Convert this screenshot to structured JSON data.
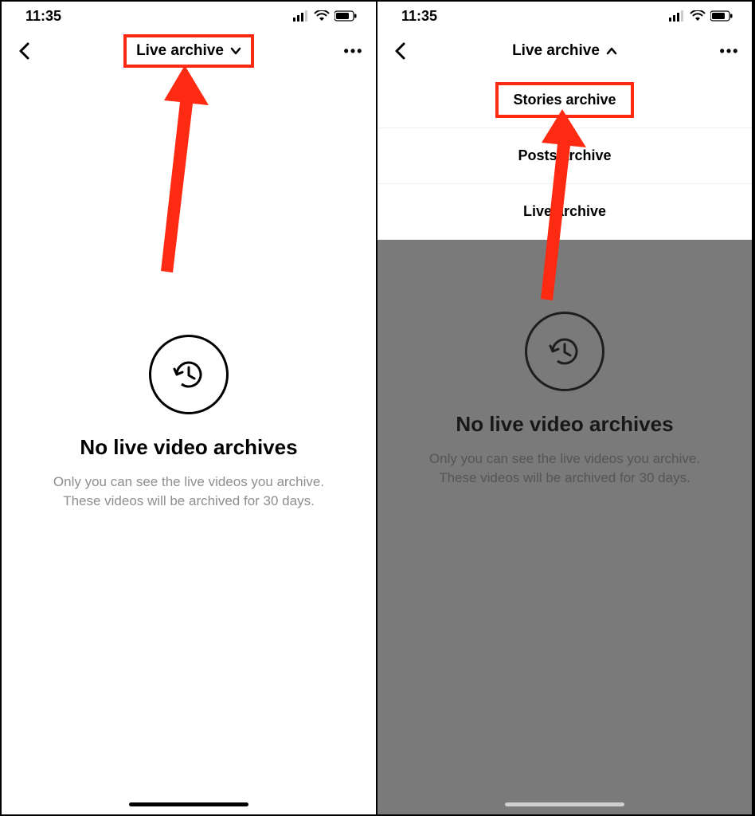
{
  "status": {
    "time": "11:35"
  },
  "nav": {
    "title": "Live archive",
    "menu": {
      "stories": "Stories archive",
      "posts": "Posts archive",
      "live": "Live archive"
    }
  },
  "empty": {
    "heading": "No live video archives",
    "line1": "Only you can see the live videos you archive.",
    "line2": "These videos will be archived for 30 days."
  }
}
